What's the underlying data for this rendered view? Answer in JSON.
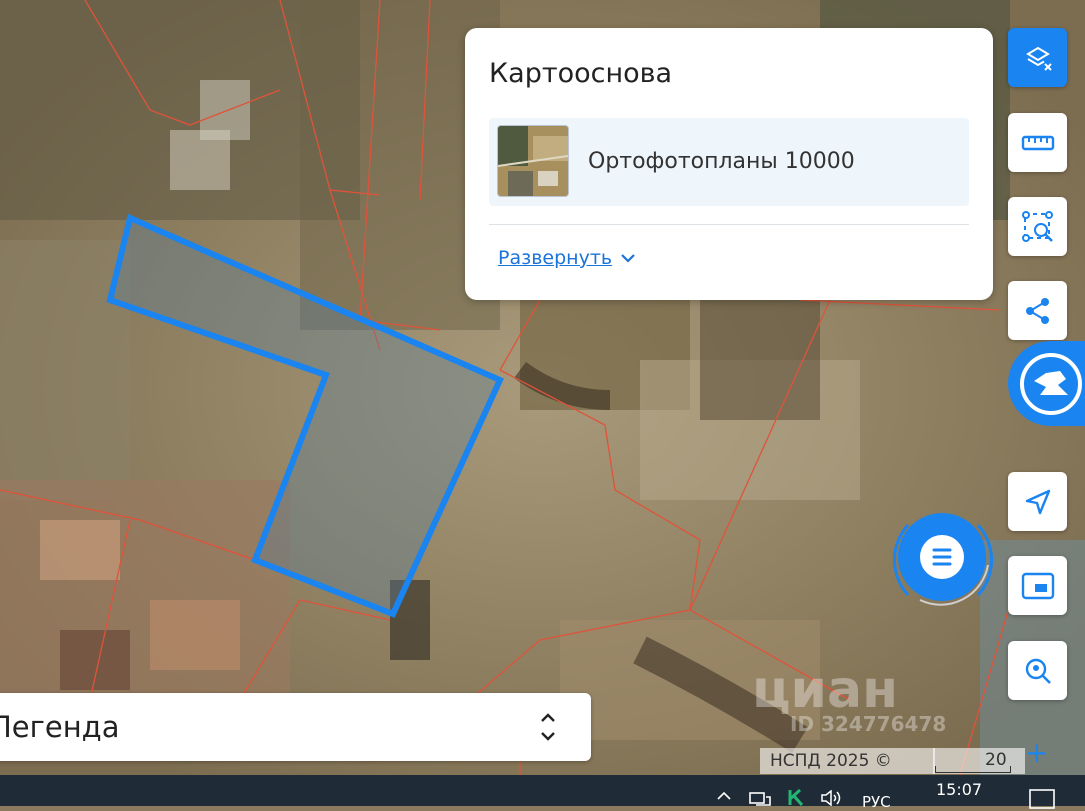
{
  "map": {
    "basemap": "satellite-orthophoto",
    "parcel_color": "#1a84f0",
    "boundary_color": "#e0533a",
    "watermark_text": "циан",
    "watermark_id": "ID 324776478"
  },
  "layer_panel": {
    "title": "Картооснова",
    "layer_name": "Ортофотопланы 10000",
    "expand_label": "Развернуть"
  },
  "tools": [
    {
      "name": "layers-toggle-icon",
      "active": true
    },
    {
      "name": "ruler-icon"
    },
    {
      "name": "area-search-icon"
    },
    {
      "name": "share-icon"
    },
    {
      "name": "brand-logo-icon"
    },
    {
      "name": "locate-icon"
    },
    {
      "name": "minimap-icon"
    },
    {
      "name": "search-location-icon"
    },
    {
      "name": "chat-icon"
    }
  ],
  "legend": {
    "label": "Легенда"
  },
  "attribution": {
    "copyright": "НСПД 2025 ©",
    "scale_label": "20 m",
    "zoom_in": "+"
  },
  "taskbar": {
    "language": "РУС",
    "time": "15:07"
  }
}
